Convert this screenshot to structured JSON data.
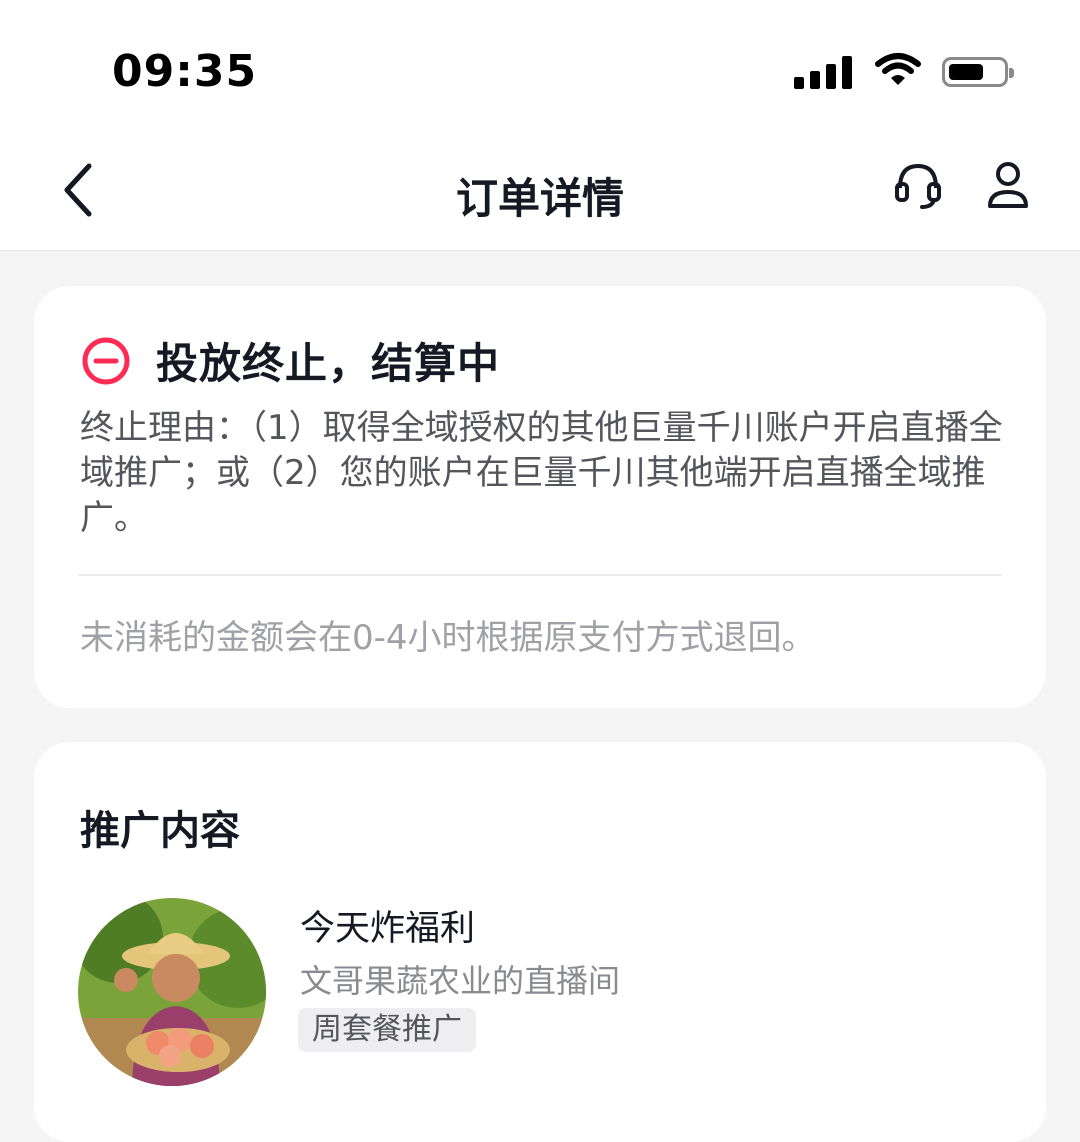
{
  "status_bar": {
    "time": "09:35",
    "icons": [
      "signal-icon",
      "wifi-icon",
      "battery-icon"
    ]
  },
  "nav": {
    "title": "订单详情",
    "icons": [
      "back-arrow-icon",
      "customer-service-headset-icon",
      "profile-icon"
    ]
  },
  "status_card": {
    "title": "投放终止，结算中",
    "status_icon": "minus-circle-icon",
    "status_color": "#fe2c55",
    "reason": "终止理由：（1）取得全域授权的其他巨量千川账户开启直播全域推广；或（2）您的账户在巨量千川其他端开启直播全域推广。",
    "refund_note": "未消耗的金额会在0-4小时根据原支付方式退回。"
  },
  "content_card": {
    "section_title": "推广内容",
    "live_name": "今天炸福利",
    "live_room": "文哥果蔬农业的直播间",
    "tag": "周套餐推广"
  }
}
